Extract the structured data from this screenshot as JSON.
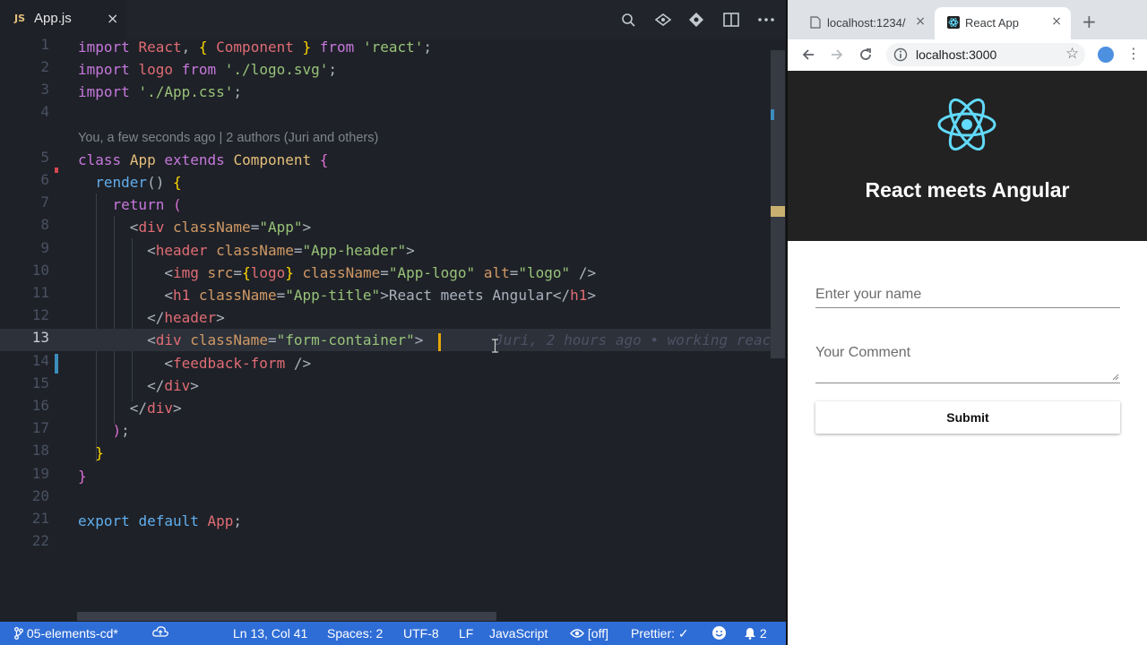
{
  "editor": {
    "tab": {
      "badge": "JS",
      "filename": "App.js",
      "close": "×"
    },
    "toolbar_icons": [
      "open-changes-icon",
      "git-lens-icon",
      "git-compare-icon",
      "split-editor-icon",
      "more-actions-icon"
    ],
    "codelens": "You, a few seconds ago | 2 authors (Juri and others)",
    "inline_blame": "Juri, 2 hours ago • working reac",
    "line_numbers": [
      "1",
      "2",
      "3",
      "4",
      "5",
      "6",
      "7",
      "8",
      "9",
      "10",
      "11",
      "12",
      "13",
      "14",
      "15",
      "16",
      "17",
      "18",
      "19",
      "20",
      "21",
      "22"
    ],
    "active_line": "13"
  },
  "statusbar": {
    "branch": "05-elements-cd*",
    "position": "Ln 13, Col 41",
    "spaces": "Spaces: 2",
    "encoding": "UTF-8",
    "eol": "LF",
    "language": "JavaScript",
    "live": "[off]",
    "prettier": "Prettier: ✓",
    "notifications": "2"
  },
  "browser": {
    "tabs": [
      {
        "title": "localhost:1234/",
        "close": "×"
      },
      {
        "title": "React App",
        "close": "×"
      }
    ],
    "new_tab": "+",
    "url": "localhost:3000",
    "page": {
      "title": "React meets Angular",
      "name_placeholder": "Enter your name",
      "comment_placeholder": "Your Comment",
      "submit_label": "Submit"
    }
  },
  "colors": {
    "statusbar": "#2f6dd6",
    "react_blue": "#61dafb",
    "app_header_bg": "#222222"
  }
}
